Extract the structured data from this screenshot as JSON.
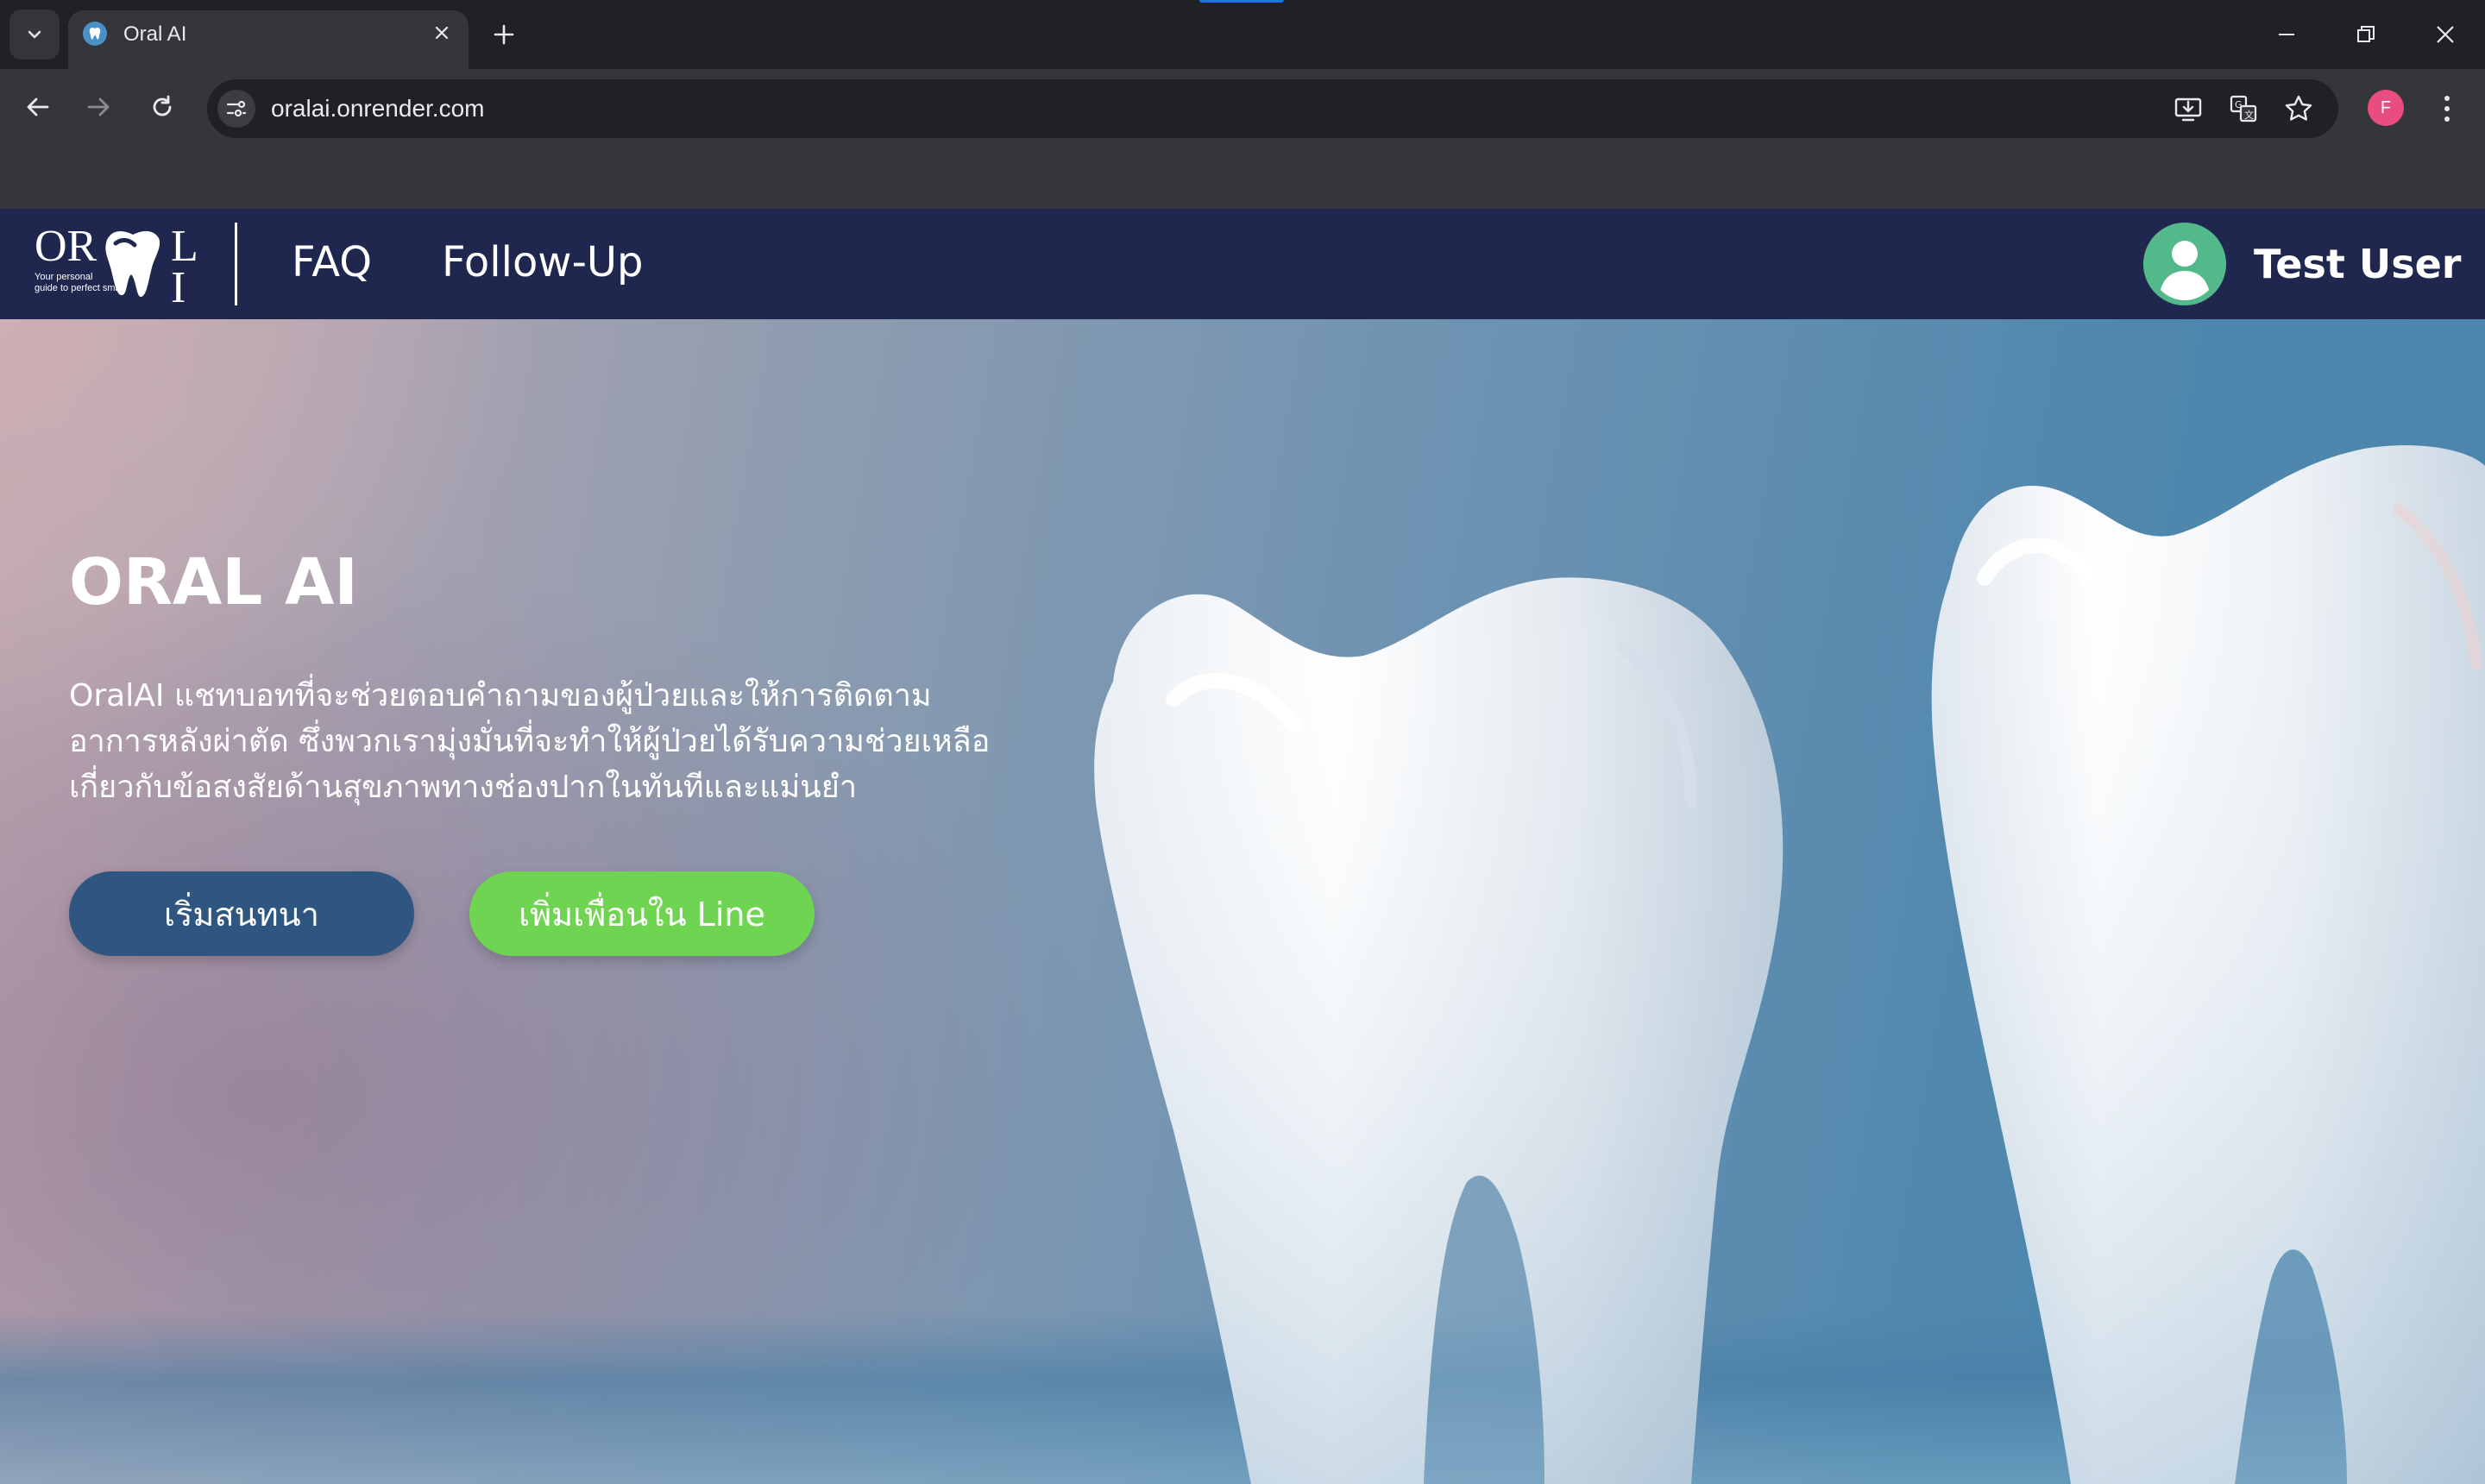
{
  "browser": {
    "tab_title": "Oral AI",
    "url": "oralai.onrender.com",
    "profile_initial": "F",
    "accent_color": "#1a73e8"
  },
  "navbar": {
    "logo": {
      "brand": "ORAL AI",
      "tagline": "Your personal guide to perfect smile"
    },
    "links": [
      {
        "label": "FAQ"
      },
      {
        "label": "Follow-Up"
      }
    ],
    "user_name": "Test User",
    "background": "#1f274f"
  },
  "hero": {
    "title": "ORAL AI",
    "description": "OralAI แชทบอทที่จะช่วยตอบคำถามของผู้ป่วยและให้การติดตามอาการหลังผ่าตัด ซึ่งพวกเรามุ่งมั่นที่จะทำให้ผู้ป่วยได้รับความช่วยเหลือเกี่ยวกับข้อสงสัยด้านสุขภาพทางช่องปากในทันทีและแม่นยำ",
    "buttons": {
      "start_chat": "เริ่มสนทนา",
      "add_line": "เพิ่มเพื่อนใน Line"
    },
    "colors": {
      "start_button": "#2e5680",
      "line_button": "#6ed452"
    }
  },
  "icons": {
    "tab_search": "chevron-down-icon",
    "favicon": "tooth-icon",
    "close": "close-icon",
    "new_tab": "plus-icon",
    "back": "arrow-left-icon",
    "forward": "arrow-right-icon",
    "reload": "reload-icon",
    "site_info": "tune-icon",
    "install": "install-app-icon",
    "translate": "translate-icon",
    "bookmark": "star-icon",
    "menu": "kebab-menu-icon"
  }
}
